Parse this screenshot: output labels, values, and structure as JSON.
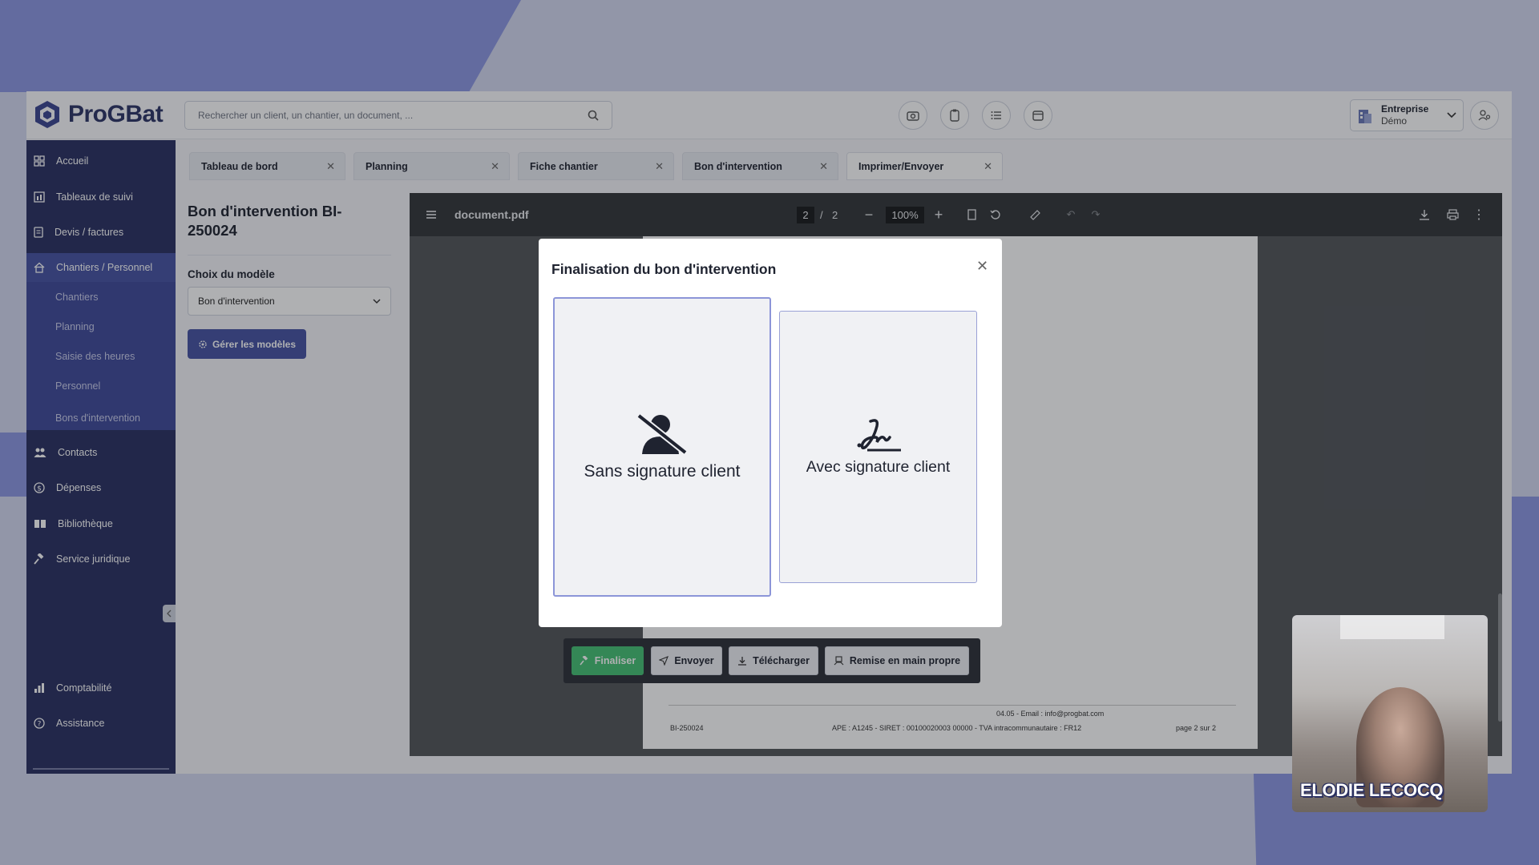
{
  "app": {
    "brand": "ProGBat",
    "search_placeholder": "Rechercher un client, un chantier, un document, ...",
    "toolbar_icons": [
      "camera-icon",
      "clipboard-icon",
      "list-icon",
      "calendar-icon"
    ],
    "company": {
      "name": "Entreprise",
      "subtitle": "Démo"
    }
  },
  "sidebar": {
    "items": [
      {
        "label": "Accueil",
        "icon": "home-grid-icon"
      },
      {
        "label": "Tableaux de suivi",
        "icon": "chart-icon"
      },
      {
        "label": "Devis / factures",
        "icon": "document-icon"
      },
      {
        "label": "Chantiers / Personnel",
        "icon": "house-icon"
      },
      {
        "label": "Contacts",
        "icon": "people-icon"
      },
      {
        "label": "Dépenses",
        "icon": "money-icon"
      },
      {
        "label": "Bibliothèque",
        "icon": "book-icon"
      },
      {
        "label": "Service juridique",
        "icon": "gavel-icon"
      },
      {
        "label": "Comptabilité",
        "icon": "bar-chart-icon"
      },
      {
        "label": "Assistance",
        "icon": "question-icon"
      }
    ],
    "sub_items": [
      "Chantiers",
      "Planning",
      "Saisie des heures",
      "Personnel",
      "Bons d'intervention"
    ]
  },
  "tabs": [
    "Tableau de bord",
    "Planning",
    "Fiche chantier",
    "Bon d'intervention",
    "Imprimer/Envoyer"
  ],
  "panel": {
    "title": "Bon d'intervention BI-250024",
    "model_label": "Choix du modèle",
    "model_value": "Bon d'intervention",
    "manage_button": "Gérer les modèles"
  },
  "viewer": {
    "filename": "document.pdf",
    "page_current": "2",
    "page_sep": "/",
    "page_total": "2",
    "zoom": "100%",
    "footer_contact": "04.05 - Email : info@progbat.com",
    "footer_ref": "BI-250024",
    "footer_legal": "APE : A1245 - SIRET : 00100020003 00000 - TVA intracommunautaire : FR12",
    "footer_page": "page 2 sur 2"
  },
  "actions": {
    "finaliser": "Finaliser",
    "envoyer": "Envoyer",
    "telecharger": "Télécharger",
    "remise": "Remise en main propre"
  },
  "modal": {
    "title": "Finalisation du bon d'intervention",
    "option_without": "Sans signature client",
    "option_with": "Avec signature client"
  },
  "webcam": {
    "name": "ELODIE LECOCQ"
  },
  "colors": {
    "sidebar": "#2a3062",
    "accent": "#4653a3",
    "finaliser": "#45c174",
    "background": "#d3d8f0"
  }
}
